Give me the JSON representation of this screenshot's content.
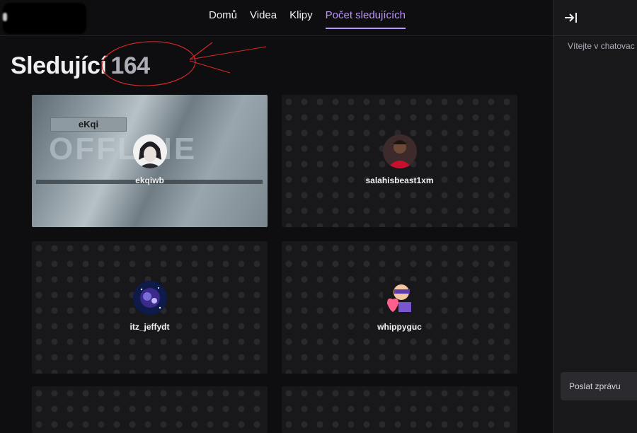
{
  "nav": {
    "items": [
      {
        "label": "Domů"
      },
      {
        "label": "Videa"
      },
      {
        "label": "Klipy"
      },
      {
        "label": "Počet sledujících"
      }
    ],
    "active_index": 3
  },
  "heading": {
    "title": "Sledující",
    "count": "164"
  },
  "followers": [
    {
      "name": "ekqiwb",
      "offline_banner_label": "eKqi",
      "offline_banner_text": "OFFLINE"
    },
    {
      "name": "salahisbeast1xm"
    },
    {
      "name": "itz_jeffydt"
    },
    {
      "name": "whippyguc"
    }
  ],
  "chat": {
    "welcome": "Vítejte v chatovac",
    "input_placeholder": "Poslat zprávu"
  },
  "colors": {
    "accent": "#bf94ff",
    "annotation": "#d62828"
  },
  "icons": {
    "collapse": "arrow-right-to-bar-icon"
  }
}
